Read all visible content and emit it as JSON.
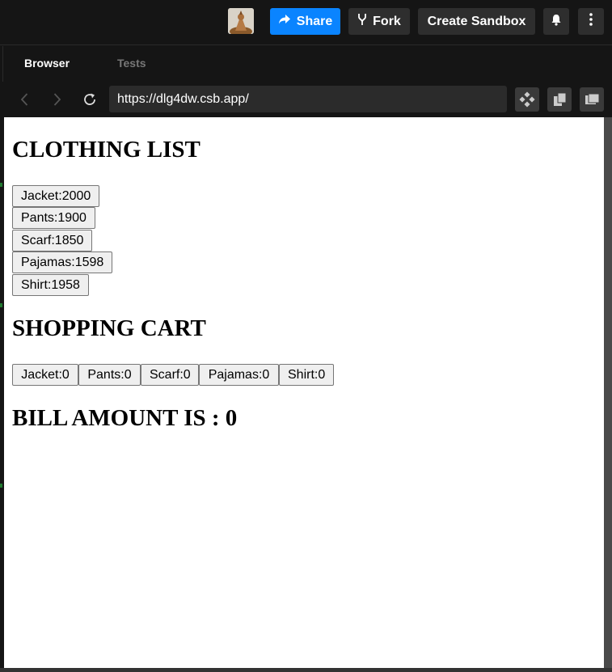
{
  "header": {
    "share_label": "Share",
    "fork_label": "Fork",
    "create_sandbox_label": "Create Sandbox"
  },
  "tabs": [
    {
      "label": "Browser",
      "active": true
    },
    {
      "label": "Tests",
      "active": false
    }
  ],
  "browser": {
    "url": "https://dlg4dw.csb.app/"
  },
  "page": {
    "clothing_title": "CLOTHING LIST",
    "clothing_items": [
      "Jacket:2000",
      "Pants:1900",
      "Scarf:1850",
      "Pajamas:1598",
      "Shirt:1958"
    ],
    "cart_title": "SHOPPING CART",
    "cart_items": [
      "Jacket:0",
      "Pants:0",
      "Scarf:0",
      "Pajamas:0",
      "Shirt:0"
    ],
    "bill_text": "BILL AMOUNT IS : 0"
  },
  "colors": {
    "share_button": "#0a84ff",
    "chrome_bg": "#151515"
  },
  "icons": [
    "avatar",
    "share-arrow-icon",
    "fork-icon",
    "bell-icon",
    "more-vertical-icon",
    "back-icon",
    "forward-icon",
    "reload-icon",
    "devtools-icon",
    "open-new-window-icon",
    "responsive-view-icon"
  ]
}
